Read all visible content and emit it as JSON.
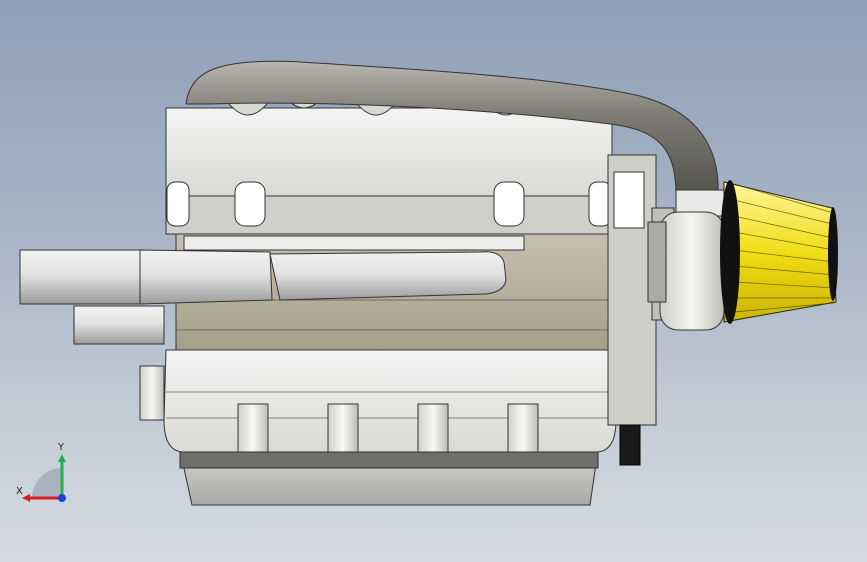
{
  "viewport": {
    "model": "engine-assembly-side-view"
  },
  "triad": {
    "x_label": "X",
    "y_label": "Y",
    "x_color": "#d81e1e",
    "y_color": "#22b14c",
    "z_color": "#1e3fd8"
  },
  "colors": {
    "background_top": "#8f9fb6",
    "background_bottom": "#d6dbe1",
    "air_filter": "#f2e21a",
    "pipe_metal": "#8a8a86"
  }
}
